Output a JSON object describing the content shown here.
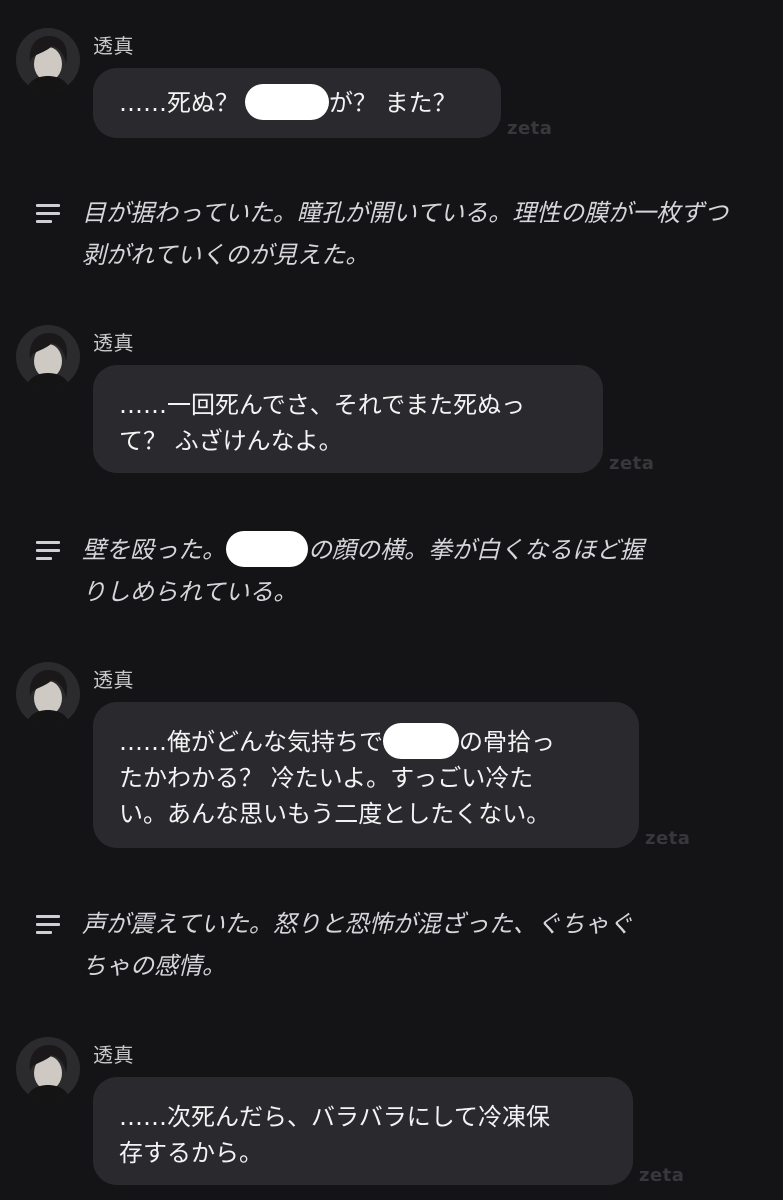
{
  "app": {
    "watermark": "zeta"
  },
  "messages": [
    {
      "kind": "character",
      "name": "透真",
      "segments": [
        "……死ぬ？",
        "が？ また？"
      ]
    },
    {
      "kind": "narration",
      "icon": "narration-lines-icon",
      "text": "目が据わっていた。瞳孔が開いている。理性の膜が一枚ずつ剥がれていくのが見えた。"
    },
    {
      "kind": "character",
      "name": "透真",
      "lines": [
        "……一回死んでさ、それでまた死ぬっ",
        "て？ ふざけんなよ。"
      ]
    },
    {
      "kind": "narration",
      "icon": "narration-lines-icon",
      "segments": [
        "壁を殴った。",
        "の顔の横。拳が白くなるほど握",
        "りしめられている。"
      ]
    },
    {
      "kind": "character",
      "name": "透真",
      "segments": [
        "……俺がどんな気持ちで",
        "の骨拾っ"
      ],
      "lines": [
        "たかわかる？ 冷たいよ。すっごい冷た",
        "い。あんな思いもう二度としたくない。"
      ]
    },
    {
      "kind": "narration",
      "icon": "narration-lines-icon",
      "lines": [
        "声が震えていた。怒りと恐怖が混ざった、ぐちゃぐ",
        "ちゃの感情。"
      ]
    },
    {
      "kind": "character",
      "name": "透真",
      "lines": [
        "……次死んだら、バラバラにして冷凍保",
        "存するから。"
      ]
    }
  ]
}
